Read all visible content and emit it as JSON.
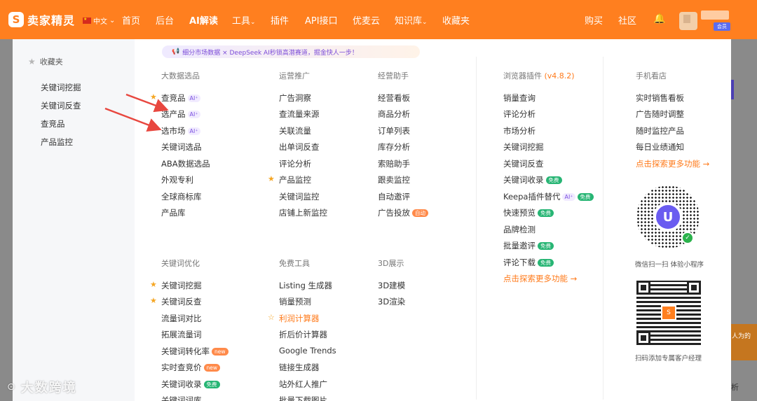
{
  "brand": {
    "name": "卖家精灵",
    "logo_letter": "S"
  },
  "lang": "中文",
  "nav": [
    "首页",
    "后台",
    "AI解读",
    "工具",
    "插件",
    "API接口",
    "优麦云",
    "知识库",
    "收藏夹"
  ],
  "nav_right": [
    "购买",
    "社区"
  ],
  "user": {
    "badge": "会员"
  },
  "favorites": {
    "title": "收藏夹",
    "items": [
      "关键词挖掘",
      "关键词反查",
      "查竞品",
      "产品监控"
    ]
  },
  "banner": "细分市场数据 × DeepSeek AI秒锁高潜赛道，掘金快人一步！",
  "columns": {
    "bigdata": {
      "head": "大数据选品",
      "items": [
        "查竞品",
        "选产品",
        "选市场",
        "关键词选品",
        "ABA数据选品",
        "外观专利",
        "全球商标库",
        "产品库"
      ]
    },
    "ops": {
      "head": "运营推广",
      "items": [
        "广告洞察",
        "查流量来源",
        "关联流量",
        "出单词反查",
        "评论分析",
        "产品监控",
        "关键词监控",
        "店铺上新监控"
      ]
    },
    "assistant": {
      "head": "经营助手",
      "items": [
        "经营看板",
        "商品分析",
        "订单列表",
        "库存分析",
        "索赔助手",
        "跟卖监控",
        "自动邀评",
        "广告投放"
      ]
    },
    "keyword": {
      "head": "关键词优化",
      "items": [
        "关键词挖掘",
        "关键词反查",
        "流量词对比",
        "拓展流量词",
        "关键词转化率",
        "实时查竞价",
        "关键词收录",
        "关键词词库"
      ]
    },
    "free": {
      "head": "免费工具",
      "items": [
        "Listing 生成器",
        "销量预测",
        "利润计算器",
        "折后价计算器",
        "Google Trends",
        "链接生成器",
        "站外红人推广",
        "批量下载图片"
      ]
    },
    "threeD": {
      "head": "3D展示",
      "items": [
        "3D建模",
        "3D渲染"
      ]
    },
    "browser": {
      "head": "浏览器插件",
      "version": "(v4.8.2)",
      "items": [
        "销量查询",
        "评论分析",
        "市场分析",
        "关键词挖掘",
        "关键词反查",
        "关键词收录",
        "Keepa插件替代",
        "快速预览",
        "品牌检测",
        "批量邀评",
        "评论下载"
      ],
      "more": "点击探索更多功能 →"
    },
    "mobile": {
      "head": "手机看店",
      "items": [
        "实时销售看板",
        "广告随时调整",
        "随时监控产品",
        "每日业绩通知"
      ],
      "more": "点击探索更多功能 →",
      "qr1_caption": "微信扫一扫 体验小程序",
      "qr2_caption": "扫码添加专属客户经理"
    }
  },
  "tags": {
    "ai": "AI⁺",
    "free": "免费",
    "new": "new",
    "auto": "自动"
  },
  "edge": {
    "orange_text": "人为的",
    "gray_text": "析"
  },
  "watermark": "大数跨境",
  "colors": {
    "brand": "#ff7f1f",
    "highlight": "#ff7a1a",
    "ai_tag": "#7a4fe0",
    "free_tag": "#27b574",
    "arrow": "#e8473f"
  }
}
